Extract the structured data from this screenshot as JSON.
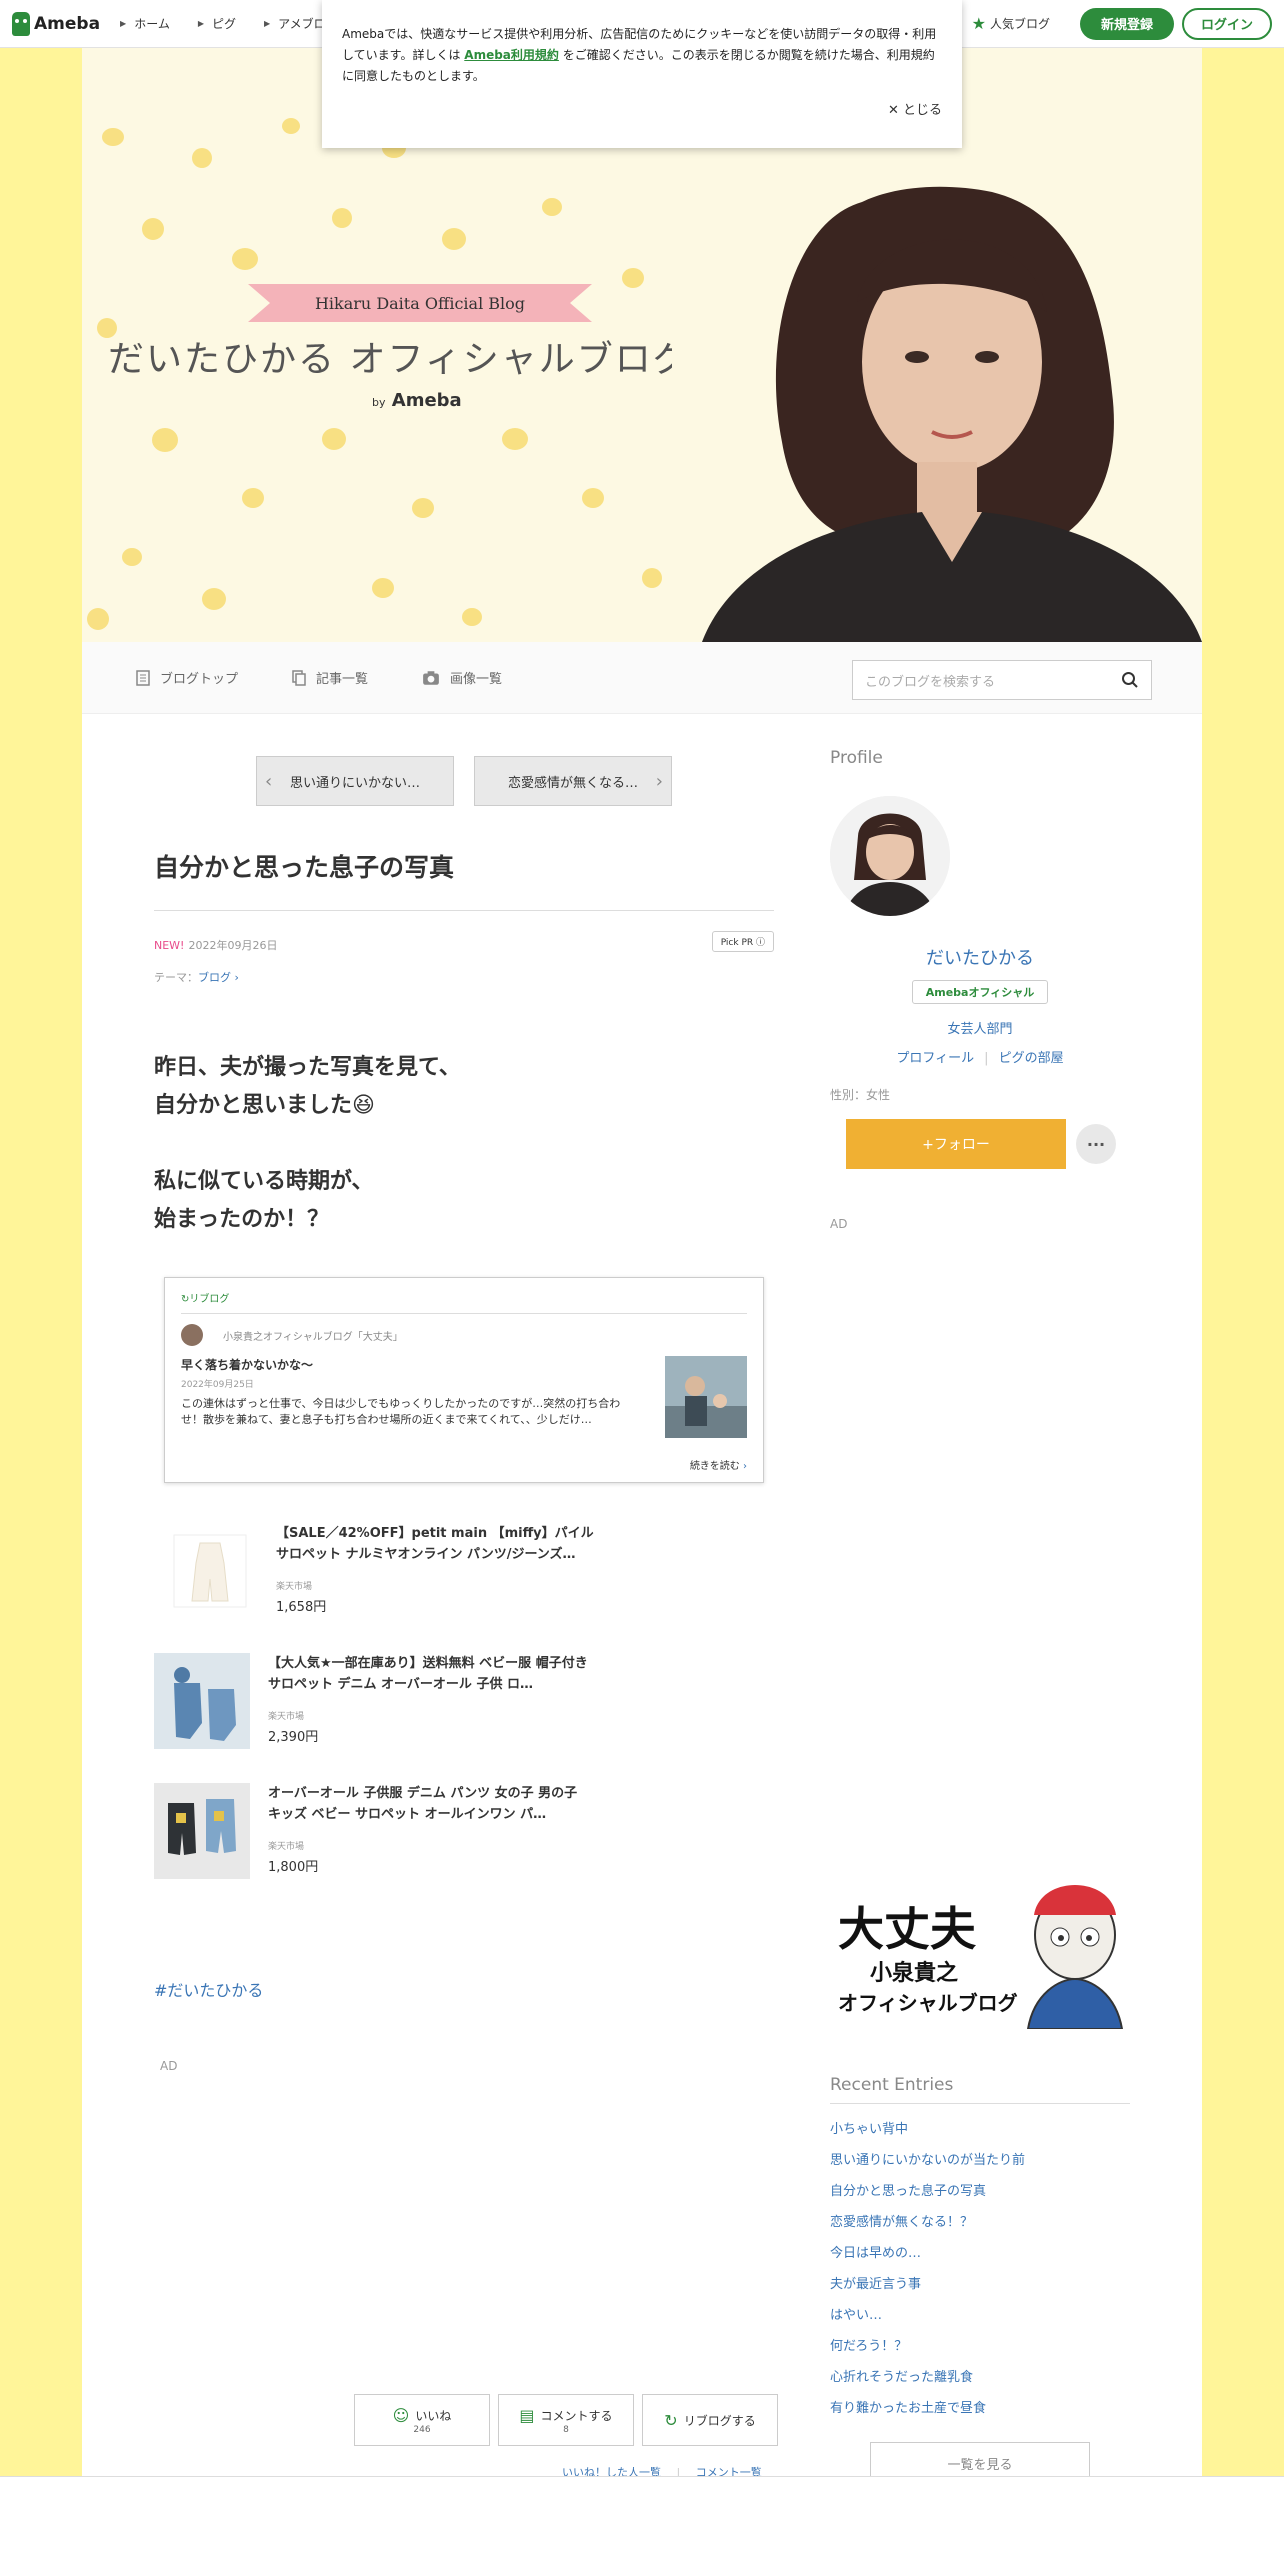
{
  "topbar": {
    "logo": "Ameba",
    "nav": [
      "ホーム",
      "ピグ",
      "アメブロ"
    ],
    "popular": "人気ブログ",
    "register": "新規登録",
    "login": "ログイン"
  },
  "cookie": {
    "text_before": "Amebaでは、快適なサービス提供や利用分析、広告配信のためにクッキーなどを使い訪問データの取得・利用しています。詳しくは",
    "link": "Ameba利用規約",
    "text_after": "をご確認ください。この表示を閉じるか閲覧を続けた場合、利用規約に同意したものとします。",
    "close": "とじる"
  },
  "header": {
    "ribbon": "Hikaru Daita Official Blog",
    "title": "だいたひかる オフィシャルブログ",
    "by": "by",
    "ameba": "Ameba"
  },
  "blognav": {
    "top": "ブログトップ",
    "entries": "記事一覧",
    "images": "画像一覧",
    "search_placeholder": "このブログを検索する"
  },
  "article": {
    "prev": "思い通りにいかない…",
    "next": "恋愛感情が無くなる…",
    "title": "自分かと思った息子の写真",
    "new_label": "NEW!",
    "date": "2022年09月26日",
    "pickpr": "Pick PR ⓘ",
    "theme_label": "テーマ：",
    "theme": "ブログ",
    "para1_line1": "昨日、夫が撮った写真を見て、",
    "para1_line2": "自分かと思いました😆",
    "para2_line1": "私に似ている時期が、",
    "para2_line2": "始まったのか！？",
    "hashtag": "#だいたひかる",
    "ad": "AD"
  },
  "reblog": {
    "label": "リブログ",
    "author": "小泉貴之オフィシャルブログ「大丈夫」",
    "title": "早く落ち着かないかな〜",
    "date": "2022年09月25日",
    "excerpt": "この連休はずっと仕事で、今日は少しでもゆっくりしたかったのですが…突然の打ち合わせ！散歩を兼ねて、妻と息子も打ち合わせ場所の近くまで来てくれて、、少しだけ…",
    "more": "続きを読む"
  },
  "products": [
    {
      "name": "【SALE／42%OFF】petit main 【miffy】パイルサロペット ナルミヤオンライン パンツ/ジーンズ…",
      "shop": "楽天市場",
      "price": "1,658円"
    },
    {
      "name": "【大人気★一部在庫あり】送料無料 ベビー服 帽子付きサロペット デニム オーバーオール 子供 ロ…",
      "shop": "楽天市場",
      "price": "2,390円"
    },
    {
      "name": "オーバーオール 子供服 デニム パンツ 女の子 男の子 キッズ ベビー サロペット オールインワン パ…",
      "shop": "楽天市場",
      "price": "1,800円"
    }
  ],
  "actions": {
    "like": "いいね",
    "like_count": "246",
    "comment": "コメントする",
    "comment_count": "8",
    "reblog": "リブログする",
    "liked_users": "いいね！した人一覧",
    "comment_list": "コメント一覧"
  },
  "sidebar": {
    "profile_heading": "Profile",
    "name": "だいたひかる",
    "badge": "Amebaオフィシャル",
    "category": "女芸人部門",
    "profile_link": "プロフィール",
    "pig_link": "ピグの部屋",
    "sex": "性別：女性",
    "follow": "+フォロー",
    "more": "···",
    "ad": "AD",
    "banner_line1": "大丈夫",
    "banner_line2": "小泉貴之",
    "banner_line3": "オフィシャルブログ",
    "recent_heading": "Recent Entries",
    "recent": [
      "小ちゃい背中",
      "思い通りにいかないのが当たり前",
      "自分かと思った息子の写真",
      "恋愛感情が無くなる！？",
      "今日は早めの…",
      "夫が最近言う事",
      "はやい…",
      "何だろう！？",
      "心折れそうだった離乳食",
      "有り難かったお土産で昼食"
    ],
    "see_all": "一覧を見る"
  },
  "colors": {
    "accent": "#2d8c3c",
    "link": "#3a75b5",
    "follow": "#f0b033",
    "page_bg": "#fff599"
  }
}
